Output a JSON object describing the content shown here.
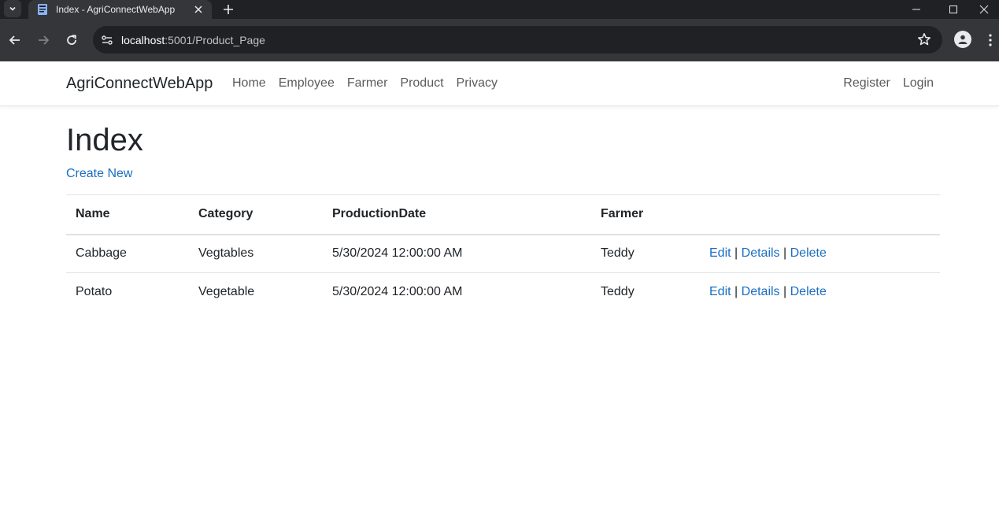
{
  "browser": {
    "tab_title": "Index - AgriConnectWebApp",
    "url_host": "localhost",
    "url_path": ":5001/Product_Page"
  },
  "navbar": {
    "brand": "AgriConnectWebApp",
    "links": [
      "Home",
      "Employee",
      "Farmer",
      "Product",
      "Privacy"
    ],
    "right_links": [
      "Register",
      "Login"
    ]
  },
  "page": {
    "title": "Index",
    "create_link": "Create New"
  },
  "table": {
    "headers": [
      "Name",
      "Category",
      "ProductionDate",
      "Farmer",
      ""
    ],
    "rows": [
      {
        "name": "Cabbage",
        "category": "Vegtables",
        "date": "5/30/2024 12:00:00 AM",
        "farmer": "Teddy"
      },
      {
        "name": "Potato",
        "category": "Vegetable",
        "date": "5/30/2024 12:00:00 AM",
        "farmer": "Teddy"
      }
    ],
    "actions": {
      "edit": "Edit",
      "details": "Details",
      "delete": "Delete",
      "separator": "|"
    }
  },
  "colors": {
    "link": "#1b6ec2",
    "chrome_dark": "#202124",
    "chrome_tab": "#35363a"
  }
}
